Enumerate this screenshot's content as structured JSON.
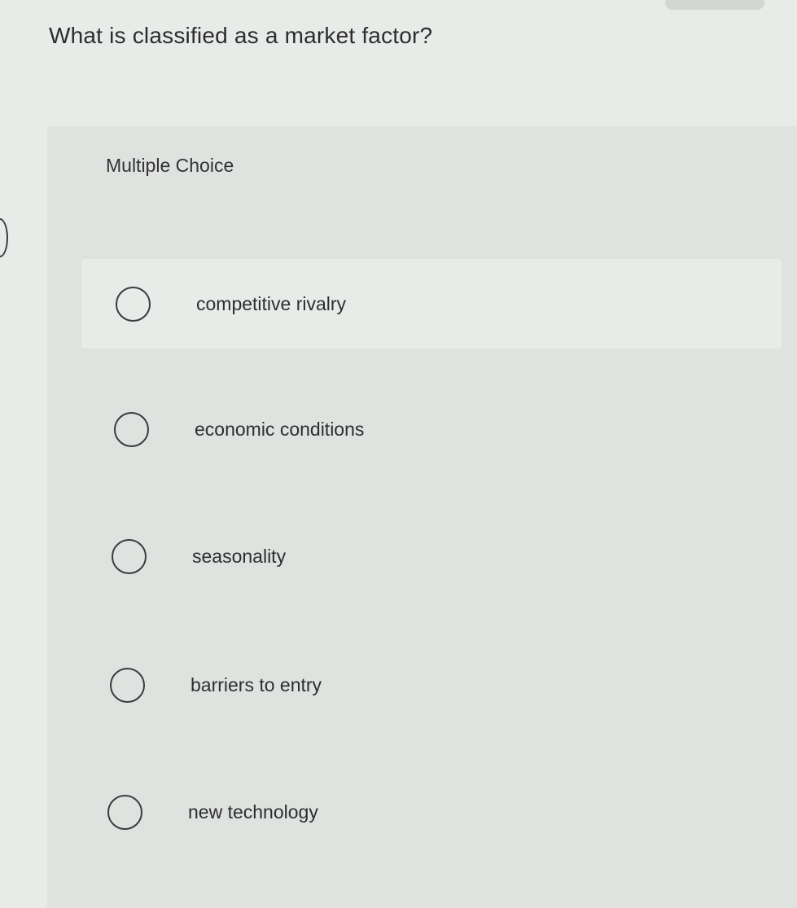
{
  "question": {
    "text": "What is classified as a market factor?"
  },
  "panel": {
    "label": "Multiple Choice"
  },
  "options": [
    {
      "label": "competitive rivalry",
      "selected": false
    },
    {
      "label": "economic conditions",
      "selected": false
    },
    {
      "label": "seasonality",
      "selected": false
    },
    {
      "label": "barriers to entry",
      "selected": false
    },
    {
      "label": "new technology",
      "selected": false
    }
  ],
  "colors": {
    "page_background": "#e9ebe8",
    "panel_background": "#e0e2df",
    "text": "#2b2c2e",
    "radio_border": "#3b3c3f"
  }
}
